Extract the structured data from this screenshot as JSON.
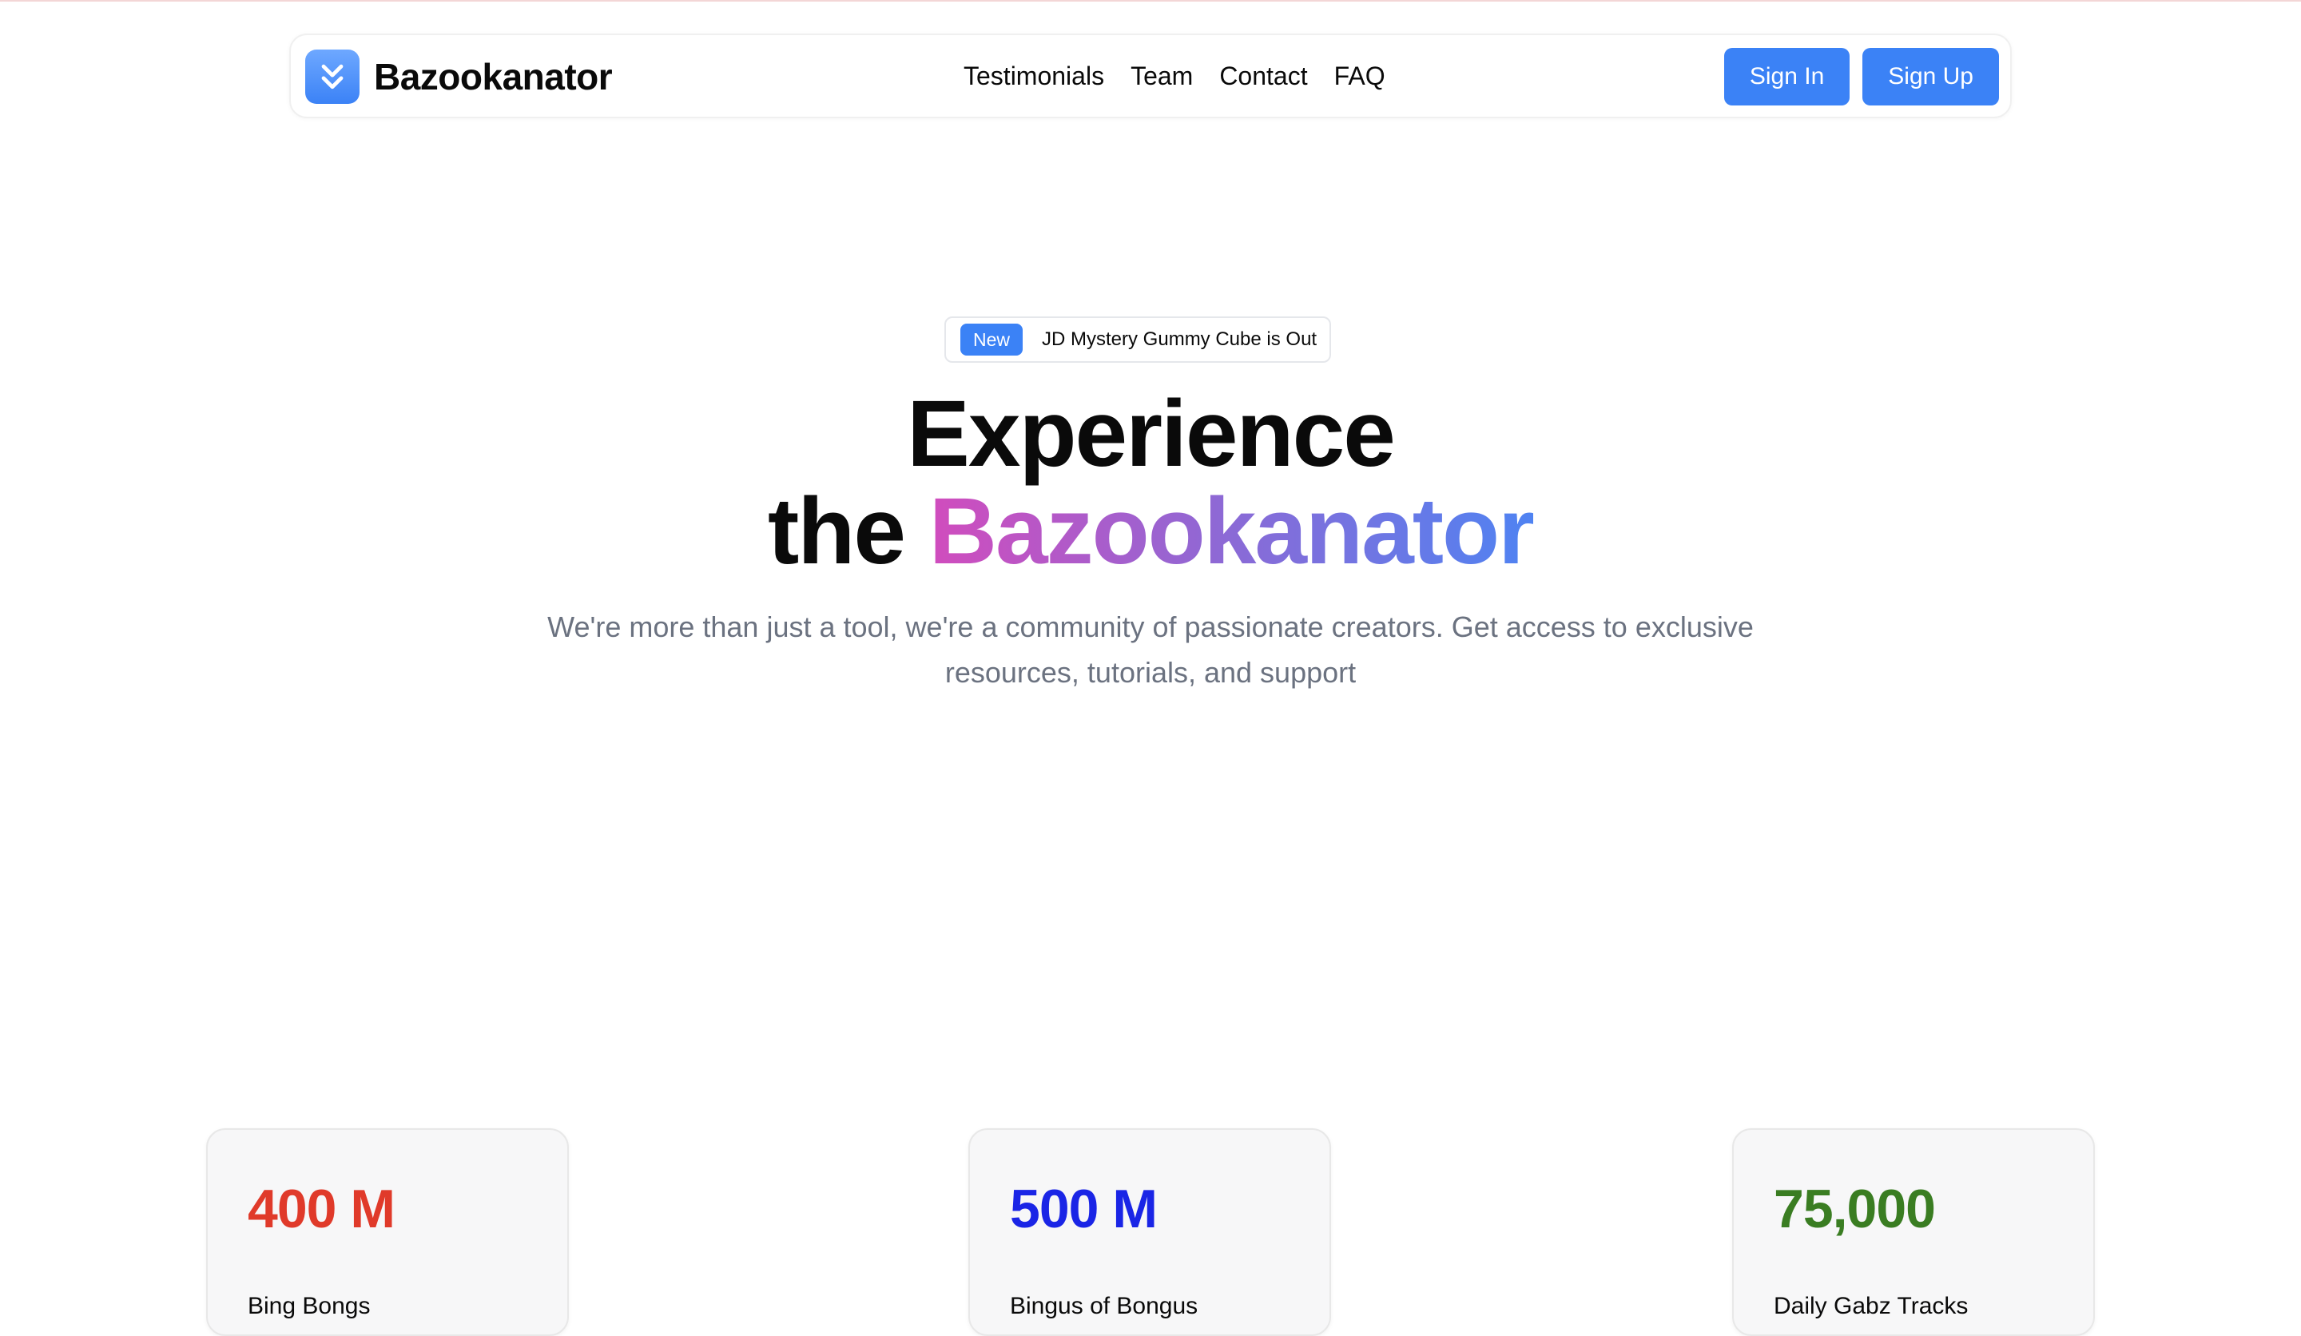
{
  "navbar": {
    "brand_name": "Bazookanator",
    "links": [
      "Testimonials",
      "Team",
      "Contact",
      "FAQ"
    ],
    "sign_in_label": "Sign In",
    "sign_up_label": "Sign Up",
    "logo_icon": "chevrons-down-icon"
  },
  "hero": {
    "announcement": {
      "badge": "New",
      "text": "JD Mystery Gummy Cube is Out"
    },
    "title_line1": "Experience",
    "title_line2_prefix": "the",
    "title_line2_highlight": "Bazookanator",
    "subtitle": "We're more than just a tool, we're a community of passionate creators. Get access to exclusive resources, tutorials, and support"
  },
  "stats": [
    {
      "value": "400 M",
      "label": "Bing Bongs",
      "color": "#e03a2a"
    },
    {
      "value": "500 M",
      "label": "Bingus of Bongus",
      "color": "#1a25e6"
    },
    {
      "value": "75,000",
      "label": "Daily Gabz Tracks",
      "color": "#3a7d22"
    }
  ],
  "colors": {
    "accent": "#3b82f6",
    "gradient_start": "#d14cbd",
    "gradient_end": "#4f83f2"
  }
}
